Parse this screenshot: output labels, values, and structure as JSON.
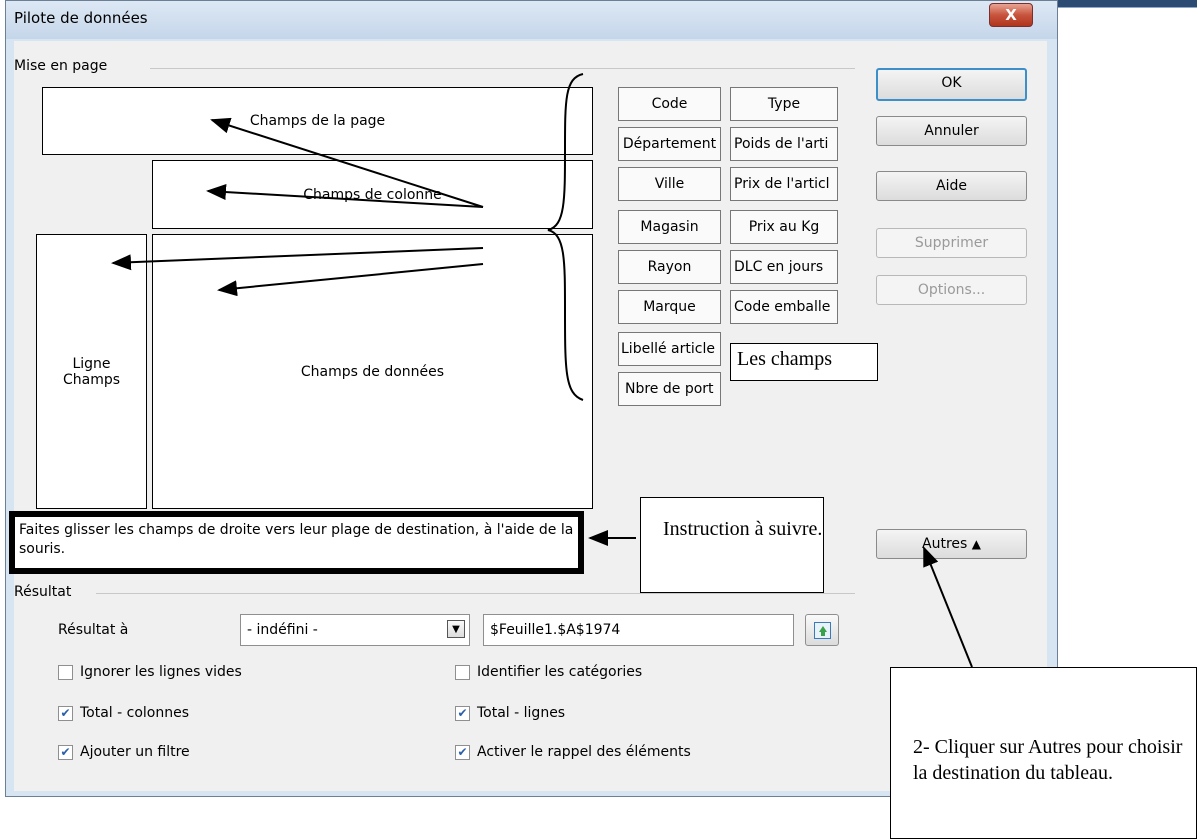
{
  "window": {
    "title": "Pilote de données",
    "close_label": "X"
  },
  "layout_section": {
    "label": "Mise en page",
    "page_fields": "Champs de la page",
    "column_fields": "Champs de colonne",
    "row_fields": "Ligne\nChamps",
    "data_fields": "Champs de données"
  },
  "fields": [
    "Code",
    "Type",
    "Département",
    "Poids de l'arti",
    "Ville",
    "Prix de l'articl",
    "Magasin",
    "Prix au Kg",
    "Rayon",
    "DLC en jours",
    "Marque",
    "Code emballe",
    "Libellé article",
    "Nbre de port"
  ],
  "buttons": {
    "ok": "OK",
    "cancel": "Annuler",
    "help": "Aide",
    "delete": "Supprimer",
    "options": "Options...",
    "more": "Autres",
    "more_icon": "double-chevron-up-icon"
  },
  "instruction": "Faites glisser les champs de droite vers leur plage de destination, à l'aide de la souris.",
  "result_section": {
    "label": "Résultat",
    "result_to_label": "Résultat à",
    "destination_select": "- indéfini -",
    "destination_input": "$Feuille1.$A$1974",
    "shrink_icon": "shrink-icon"
  },
  "options": {
    "ignore_empty_rows": {
      "label": "Ignorer les lignes vides",
      "checked": false
    },
    "identify_categories": {
      "label": "Identifier les catégories",
      "checked": false
    },
    "total_columns": {
      "label": "Total - colonnes",
      "checked": true
    },
    "total_rows": {
      "label": "Total - lignes",
      "checked": true
    },
    "add_filter": {
      "label": "Ajouter un filtre",
      "checked": true
    },
    "enable_drill": {
      "label": "Activer le rappel des éléments",
      "checked": true
    }
  },
  "annotations": {
    "fields_note": "Les champs",
    "instruction_note": "Instruction à suivre.",
    "autres_note": "2- Cliquer sur Autres pour choisir la destination du tableau."
  }
}
